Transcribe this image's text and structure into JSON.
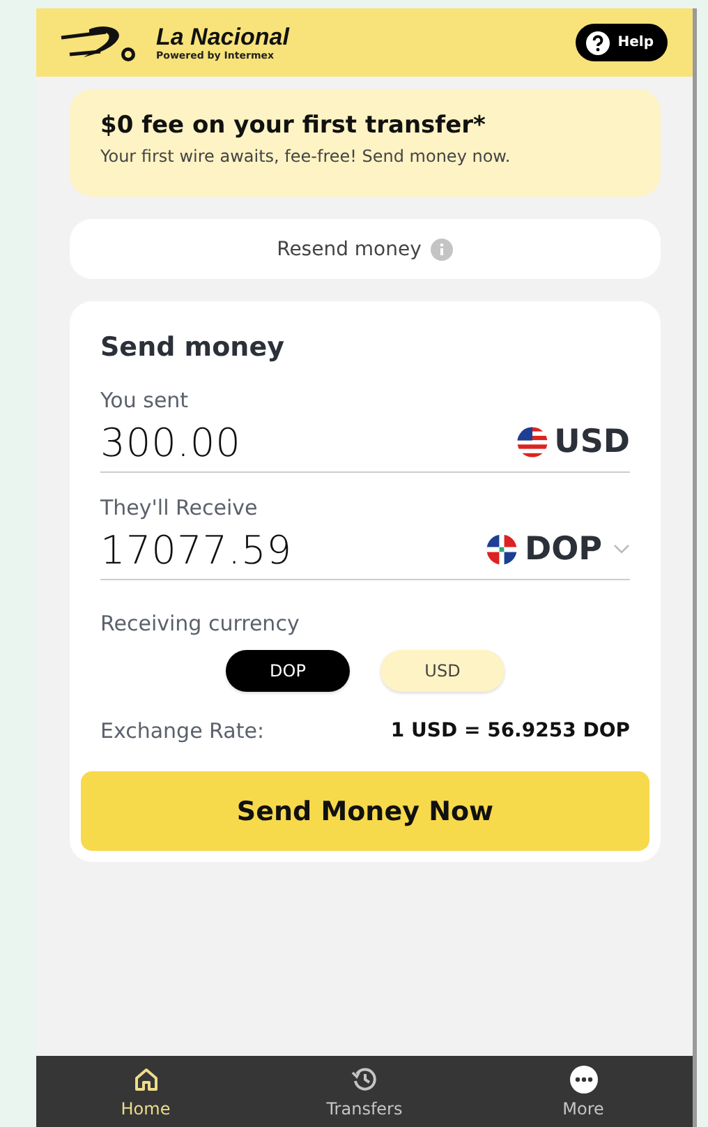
{
  "header": {
    "brand": "La Nacional",
    "tagline": "Powered by Intermex",
    "help_button": "Help"
  },
  "promo": {
    "title": "$0 fee on your first transfer*",
    "text": "Your first wire awaits, fee-free! Send money now."
  },
  "resend": {
    "label": "Resend money"
  },
  "send_card": {
    "title": "Send money",
    "fields": [
      {
        "label": "You sent",
        "value": "300.00",
        "currency": "USD",
        "kind": "us",
        "dropdown": false
      },
      {
        "label": "They'll Receive",
        "value": "17077.59",
        "currency": "DOP",
        "kind": "do",
        "dropdown": true
      }
    ],
    "receiving_currency": {
      "label": "Receiving currency",
      "options": [
        {
          "label": "DOP",
          "selected": true
        },
        {
          "label": "USD",
          "selected": false
        }
      ]
    },
    "exchange_rate": {
      "label": "Exchange Rate:",
      "value": "1 USD = 56.9253 DOP"
    },
    "button": "Send Money Now"
  },
  "nav": [
    {
      "label": "Home",
      "kind": "home",
      "selected": true
    },
    {
      "label": "Transfers",
      "kind": "history",
      "selected": false
    },
    {
      "label": "More",
      "kind": "more",
      "selected": false
    }
  ]
}
